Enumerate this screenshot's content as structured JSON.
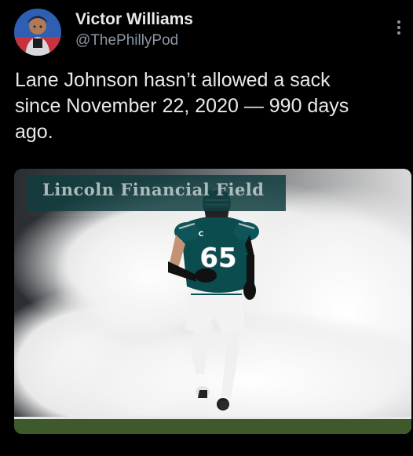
{
  "author": {
    "display_name": "Victor Williams",
    "handle": "@ThePhillyPod"
  },
  "tweet": {
    "text": "Lane Johnson hasn’t allowed a sack\nsince November 22, 2020 — 990 days\nago."
  },
  "media": {
    "stadium_sign_text": "Lincoln Financial Field",
    "jersey_number": "65",
    "captain_patch": "C"
  },
  "icons": {
    "more": "more-vertical-icon"
  },
  "colors": {
    "background": "#000000",
    "text_primary": "#e7e9ea",
    "text_secondary": "#8b98a5",
    "jersey_green": "#0b4c4f"
  }
}
